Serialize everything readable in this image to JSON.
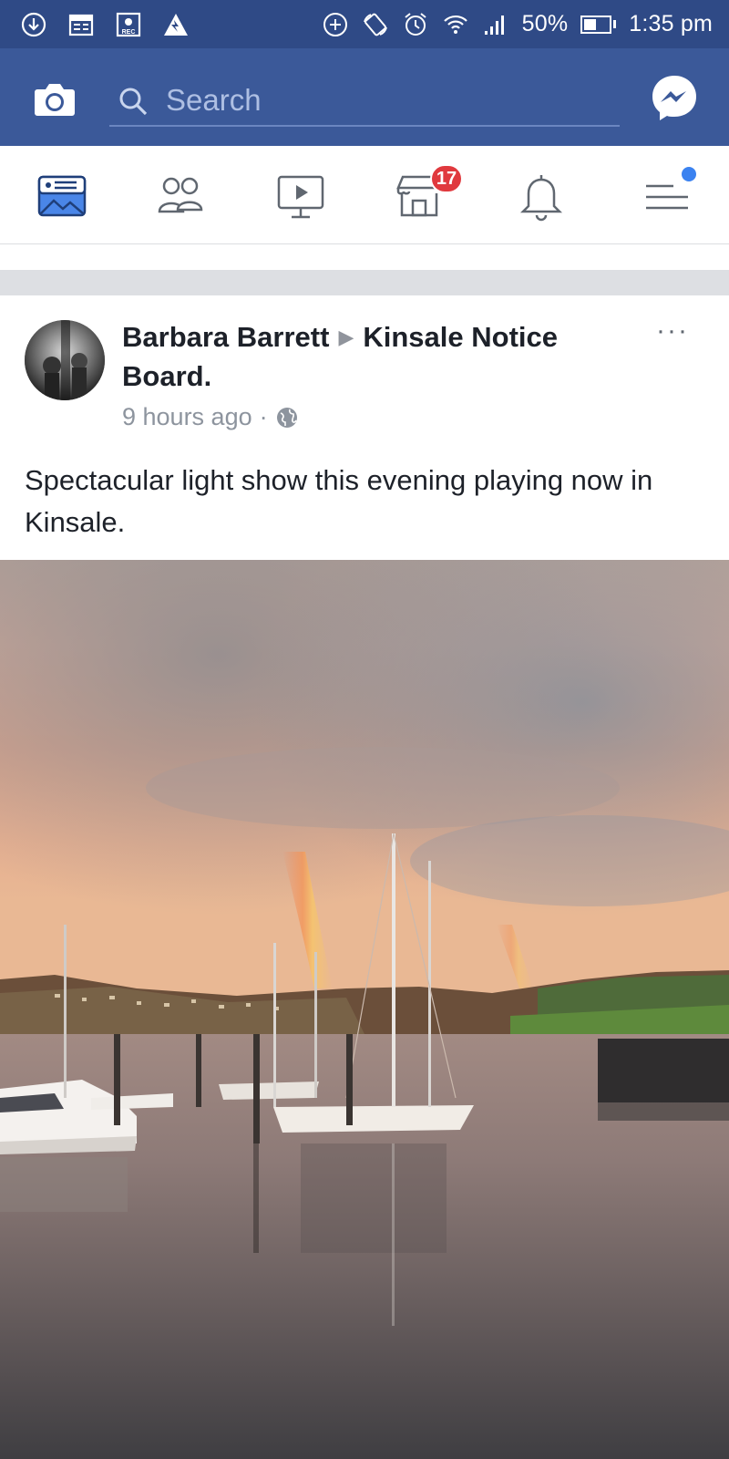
{
  "status_bar": {
    "battery": "50%",
    "time": "1:35 pm",
    "battery_level": 0.5,
    "left_icons": [
      "download-icon",
      "calendar-icon",
      "rec-icon",
      "app-icon"
    ],
    "right_icons": [
      "add-circle-icon",
      "rotate-icon",
      "alarm-icon",
      "wifi-icon",
      "signal-icon",
      "battery-icon"
    ],
    "rec_label": "REC"
  },
  "top_bar": {
    "search_placeholder": "Search",
    "icons": [
      "camera-icon",
      "search-icon",
      "messenger-icon"
    ]
  },
  "nav": {
    "items": [
      "news-feed-icon",
      "friends-icon",
      "watch-icon",
      "marketplace-icon",
      "notifications-icon",
      "menu-icon"
    ],
    "marketplace_badge": "17"
  },
  "post": {
    "author": "Barbara Barrett",
    "target": "Kinsale Notice Board.",
    "time": "9 hours ago",
    "separator": "·",
    "privacy_icon": "globe-icon",
    "more": "···",
    "text": "Spectacular light show this evening playing now in Kinsale."
  },
  "colors": {
    "status_bar": "#2f4a86",
    "top_bar": "#3b5999",
    "badge": "#e0393e",
    "accent_dot": "#3b82f0"
  }
}
